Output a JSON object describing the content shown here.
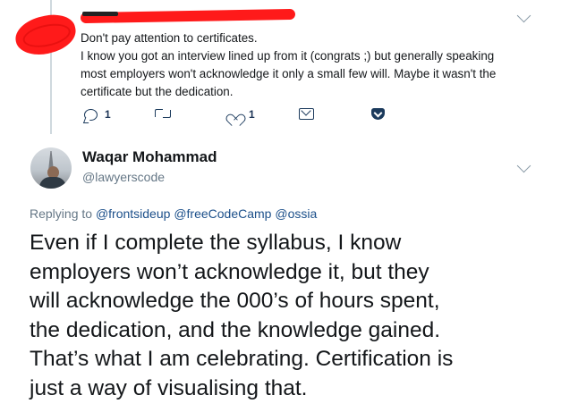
{
  "reply": {
    "lines": [
      "Don't pay attention to certificates.",
      "I know you got an interview lined up from it (congrats ;) but generally speaking",
      "most employers won't acknowledge it only a small few will. Maybe it wasn't the",
      "certificate but the dedication."
    ],
    "actions": {
      "reply_count": "1",
      "retweet_count": "",
      "like_count": "1"
    }
  },
  "tweet": {
    "display_name": "Waqar Mohammad",
    "handle": "@lawyerscode",
    "replying_prefix": "Replying to",
    "mentions": [
      "@frontsideup",
      "@freeCodeCamp",
      "@ossia"
    ],
    "text_lines": [
      "Even if I complete the syllabus, I know",
      "employers won’t acknowledge it, but they",
      "will acknowledge the 000’s of hours spent,",
      "the dedication, and the knowledge gained.",
      "That’s what I am celebrating. Certification is",
      "just a way of visualising that."
    ]
  },
  "icons": {
    "reply": "reply-icon",
    "retweet": "retweet-icon",
    "like": "heart-icon",
    "dm": "envelope-icon",
    "pocket": "pocket-icon",
    "menu": "chevron-down-icon"
  },
  "colors": {
    "redaction": "#ff1a1a",
    "link": "#1b4f8a",
    "muted": "#657786",
    "text": "#14171a"
  }
}
